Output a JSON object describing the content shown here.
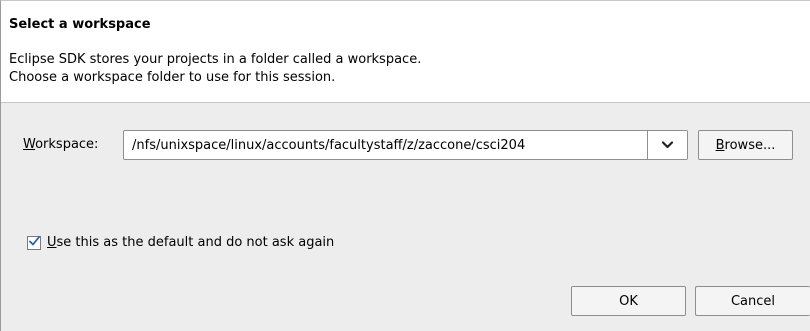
{
  "dialog": {
    "header": {
      "title": "Select a workspace",
      "message_line1": "Eclipse SDK stores your projects in a folder called a workspace.",
      "message_line2": "Choose a workspace folder to use for this session."
    },
    "workspace": {
      "label_mnemonic": "W",
      "label_rest": "orkspace:",
      "value": "/nfs/unixspace/linux/accounts/facultystaff/z/zaccone/csci204",
      "dropdown_icon": "chevron-down-icon"
    },
    "browse_button": {
      "mnemonic": "B",
      "rest": "rowse..."
    },
    "default_option": {
      "checked": true,
      "mnemonic": "U",
      "rest": "se this as the default and do not ask again"
    },
    "ok_label": "OK",
    "cancel_label": "Cancel",
    "colors": {
      "check_mark": "#2a5db0",
      "panel_background": "#ededed",
      "header_background": "#ffffff"
    }
  }
}
